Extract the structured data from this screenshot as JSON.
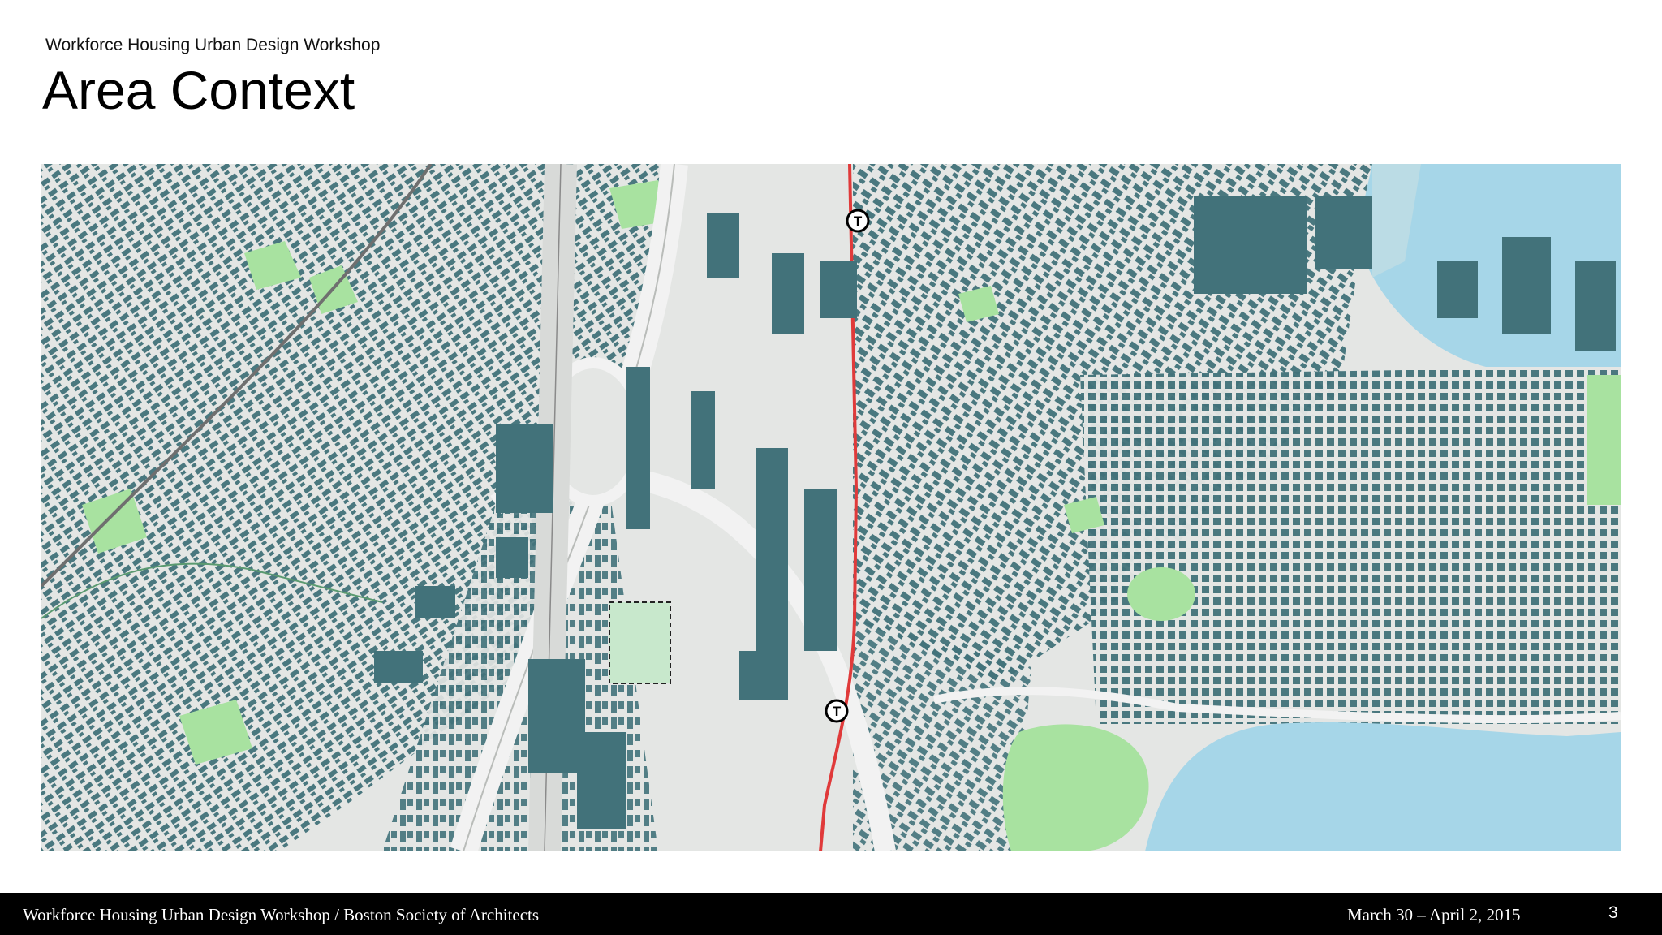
{
  "header": {
    "eyebrow": "Workforce Housing Urban Design Workshop",
    "title": "Area Context"
  },
  "map": {
    "transit_icon": "mbta-t-icon",
    "site_outline": "dashed-site-boundary",
    "colors": {
      "ground": "#e4e6e4",
      "building": "#42727a",
      "park": "#a8e2a0",
      "water": "#a6d6e8",
      "transit_line": "#e03a3a",
      "rail": "#6f6f6f"
    }
  },
  "footer": {
    "left": "Workforce Housing Urban Design Workshop / Boston Society of Architects",
    "date": "March 30 – April 2, 2015",
    "page": "3"
  }
}
